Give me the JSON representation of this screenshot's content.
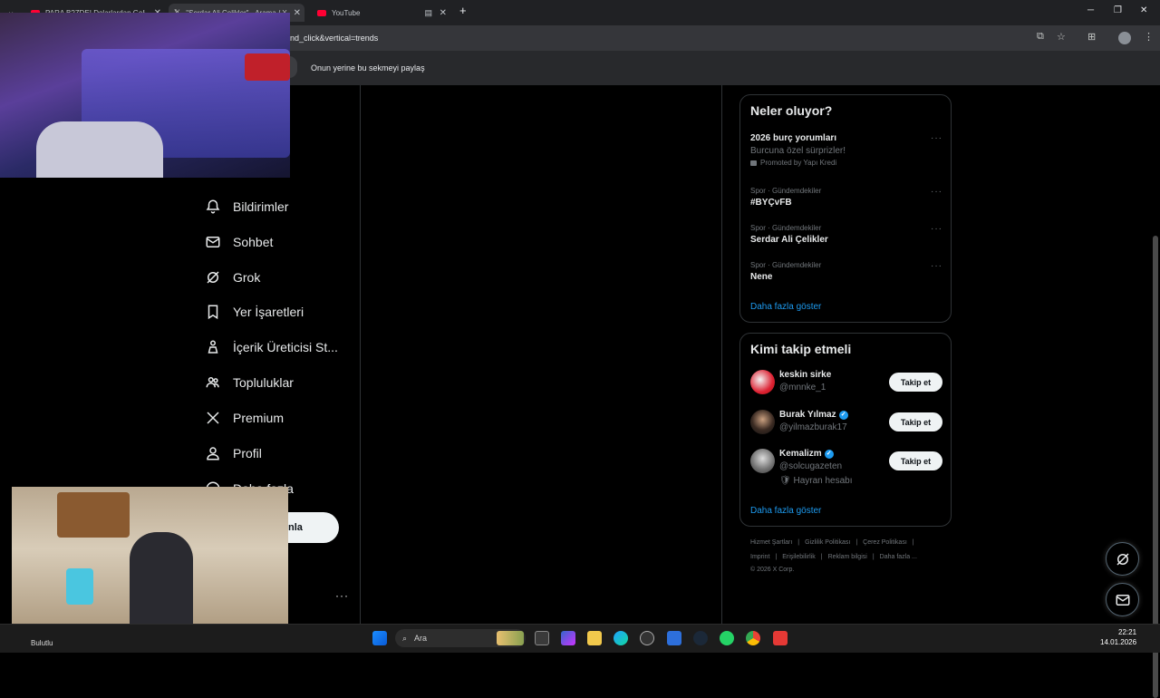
{
  "browser": {
    "tabs": [
      {
        "label": "PARA B?ZDE! Dolarlardan Geliy..."
      },
      {
        "label": "\"Serdar Ali Çelikler\" - Arama / X"
      },
      {
        "label": "YouTube"
      }
    ],
    "url": "nd_click&vertical=trends",
    "share_message": "Onun yerine bu sekmeyi paylaş"
  },
  "nav": {
    "items": [
      {
        "label": "Bildirimler",
        "icon": "bell-icon"
      },
      {
        "label": "Sohbet",
        "icon": "mail-icon"
      },
      {
        "label": "Grok",
        "icon": "grok-icon"
      },
      {
        "label": "Yer İşaretleri",
        "icon": "bookmark-icon"
      },
      {
        "label": "İçerik Üreticisi St...",
        "icon": "creator-icon"
      },
      {
        "label": "Topluluklar",
        "icon": "communities-icon"
      },
      {
        "label": "Premium",
        "icon": "x-logo-icon"
      },
      {
        "label": "Profil",
        "icon": "profile-icon"
      },
      {
        "label": "Daha fazla",
        "icon": "more-circle-icon"
      }
    ],
    "post_button": "nla",
    "more_dots": "···"
  },
  "trends": {
    "title": "Neler oluyor?",
    "items": [
      {
        "name": "2026 burç yorumları",
        "subtitle": "Burcuna özel sürprizler!",
        "promoted": "Promoted by Yapı Kredi"
      },
      {
        "category": "Spor · Gündemdekiler",
        "name": "#BYÇvFB"
      },
      {
        "category": "Spor · Gündemdekiler",
        "name": "Serdar Ali Çelikler"
      },
      {
        "category": "Spor · Gündemdekiler",
        "name": "Nene"
      }
    ],
    "show_more": "Daha fazla göster"
  },
  "who_to_follow": {
    "title": "Kimi takip etmeli",
    "users": [
      {
        "name": "keskin sirke",
        "handle": "@mnnke_1",
        "verified": false,
        "follow": "Takip et"
      },
      {
        "name": "Burak Yılmaz",
        "handle": "@yilmazburak17",
        "verified": true,
        "follow": "Takip et"
      },
      {
        "name": "Kemalizm",
        "handle": "@solcugazeten",
        "verified": true,
        "extra": "Hayran hesabı",
        "follow": "Takip et"
      }
    ],
    "show_more": "Daha fazla göster"
  },
  "footer": {
    "row1": [
      "Hizmet Şartları",
      "|",
      "Gizlilik Politikası",
      "|",
      "Çerez Politikası",
      "|"
    ],
    "row2": [
      "Imprint",
      "|",
      "Erişilebilirlik",
      "|",
      "Reklam bilgisi",
      "|",
      "Daha fazla ..."
    ],
    "copyright": "© 2026 X Corp."
  },
  "taskbar": {
    "search": "Ara",
    "time": "22:21",
    "date": "14.01.2026",
    "weather": "Bulutlu"
  }
}
